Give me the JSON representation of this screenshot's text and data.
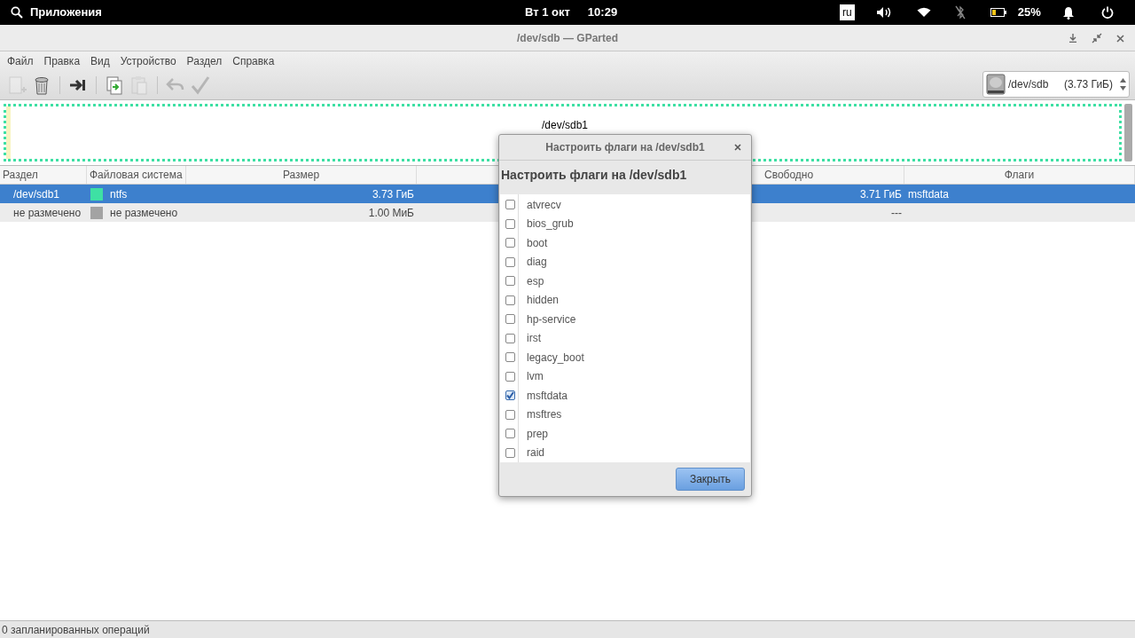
{
  "top_panel": {
    "apps_label": "Приложения",
    "date": "Вт  1 окт",
    "time": "10:29",
    "keyboard_layout": "ru",
    "battery": "25%"
  },
  "window": {
    "title": "/dev/sdb — GParted"
  },
  "menu": [
    "Файл",
    "Правка",
    "Вид",
    "Устройство",
    "Раздел",
    "Справка"
  ],
  "toolbar": [
    {
      "kind": "new",
      "disabled": true
    },
    {
      "kind": "delete",
      "disabled": false
    },
    {
      "kind": "resize",
      "disabled": false
    },
    {
      "kind": "copy",
      "disabled": false
    },
    {
      "kind": "paste",
      "disabled": true
    },
    {
      "kind": "undo",
      "disabled": true
    },
    {
      "kind": "apply",
      "disabled": true
    }
  ],
  "device_selector": {
    "device": "/dev/sdb",
    "size": "(3.73 ГиБ)"
  },
  "partition_map": {
    "label": "/dev/sdb1"
  },
  "table": {
    "columns": [
      "Раздел",
      "Файловая система",
      "Размер",
      "Свободно",
      "Флаги"
    ],
    "rows": [
      {
        "selected": true,
        "partition": "/dev/sdb1",
        "filesystem": "ntfs",
        "color": "#3ee0a4",
        "size": "3.73 ГиБ",
        "free": "3.71 ГиБ",
        "flags": "msftdata"
      },
      {
        "selected": false,
        "partition": "не размечено",
        "filesystem": "не размечено",
        "color": "#a3a3a3",
        "size": "1.00 МиБ",
        "free": "---"
      }
    ]
  },
  "dialog": {
    "title": "Настроить флаги на /dev/sdb1",
    "heading": "Настроить флаги на /dev/sdb1",
    "flags": [
      {
        "label": "atvrecv",
        "checked": false
      },
      {
        "label": "bios_grub",
        "checked": false
      },
      {
        "label": "boot",
        "checked": false
      },
      {
        "label": "diag",
        "checked": false
      },
      {
        "label": "esp",
        "checked": false
      },
      {
        "label": "hidden",
        "checked": false
      },
      {
        "label": "hp-service",
        "checked": false
      },
      {
        "label": "irst",
        "checked": false
      },
      {
        "label": "legacy_boot",
        "checked": false
      },
      {
        "label": "lvm",
        "checked": false
      },
      {
        "label": "msftdata",
        "checked": true
      },
      {
        "label": "msftres",
        "checked": false
      },
      {
        "label": "prep",
        "checked": false
      },
      {
        "label": "raid",
        "checked": false
      }
    ],
    "close_button": "Закрыть"
  },
  "status_bar": "0 запланированных операций"
}
